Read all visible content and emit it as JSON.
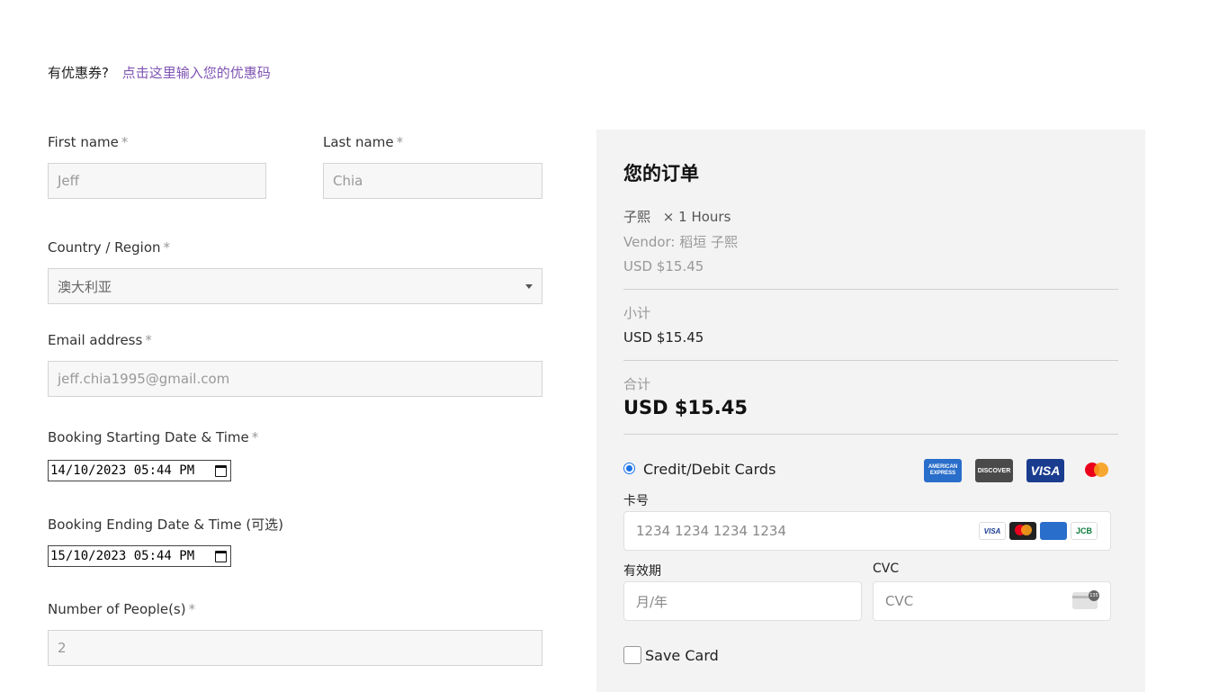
{
  "coupon": {
    "prompt": "有优惠券?",
    "link": "点击这里输入您的优惠码"
  },
  "form": {
    "first_name": {
      "label": "First name",
      "required": "*",
      "value": "Jeff"
    },
    "last_name": {
      "label": "Last name",
      "required": "*",
      "value": "Chia"
    },
    "country": {
      "label": "Country / Region",
      "required": "*",
      "value": "澳大利亚"
    },
    "email": {
      "label": "Email address",
      "required": "*",
      "value": "jeff.chia1995@gmail.com"
    },
    "start": {
      "label": "Booking Starting Date & Time",
      "required": "*",
      "value": "14/10/2023 05:44 PM"
    },
    "end": {
      "label": "Booking Ending Date & Time (可选)",
      "value": "15/10/2023 05:44 PM"
    },
    "people": {
      "label": "Number of People(s)",
      "required": "*",
      "value": "2"
    }
  },
  "order": {
    "title": "您的订单",
    "item_name": "子熙",
    "item_qty": "× 1 Hours",
    "vendor": "Vendor: 稻垣 子熙",
    "item_price": "USD $15.45",
    "subtotal_label": "小计",
    "subtotal_value": "USD $15.45",
    "total_label": "合计",
    "total_value": "USD $15.45"
  },
  "payment": {
    "method_label": "Credit/Debit Cards",
    "brands": [
      "amex-icon",
      "discover-icon",
      "visa-icon",
      "mastercard-icon"
    ],
    "card_number_label": "卡号",
    "card_number_placeholder": "1234 1234 1234 1234",
    "expiry_label": "有效期",
    "expiry_placeholder": "月/年",
    "cvc_label": "CVC",
    "cvc_placeholder": "CVC",
    "save_card_label": "Save Card",
    "amex_text": "AMERICAN EXPRESS",
    "discover_text": "DISCOVER",
    "visa_text": "VISA",
    "jcb_text": "JCB",
    "cvc_icon_text": "135"
  },
  "colors": {
    "link": "#7f54b3",
    "radio": "#1a73e8",
    "panel": "#f3f3f3"
  }
}
